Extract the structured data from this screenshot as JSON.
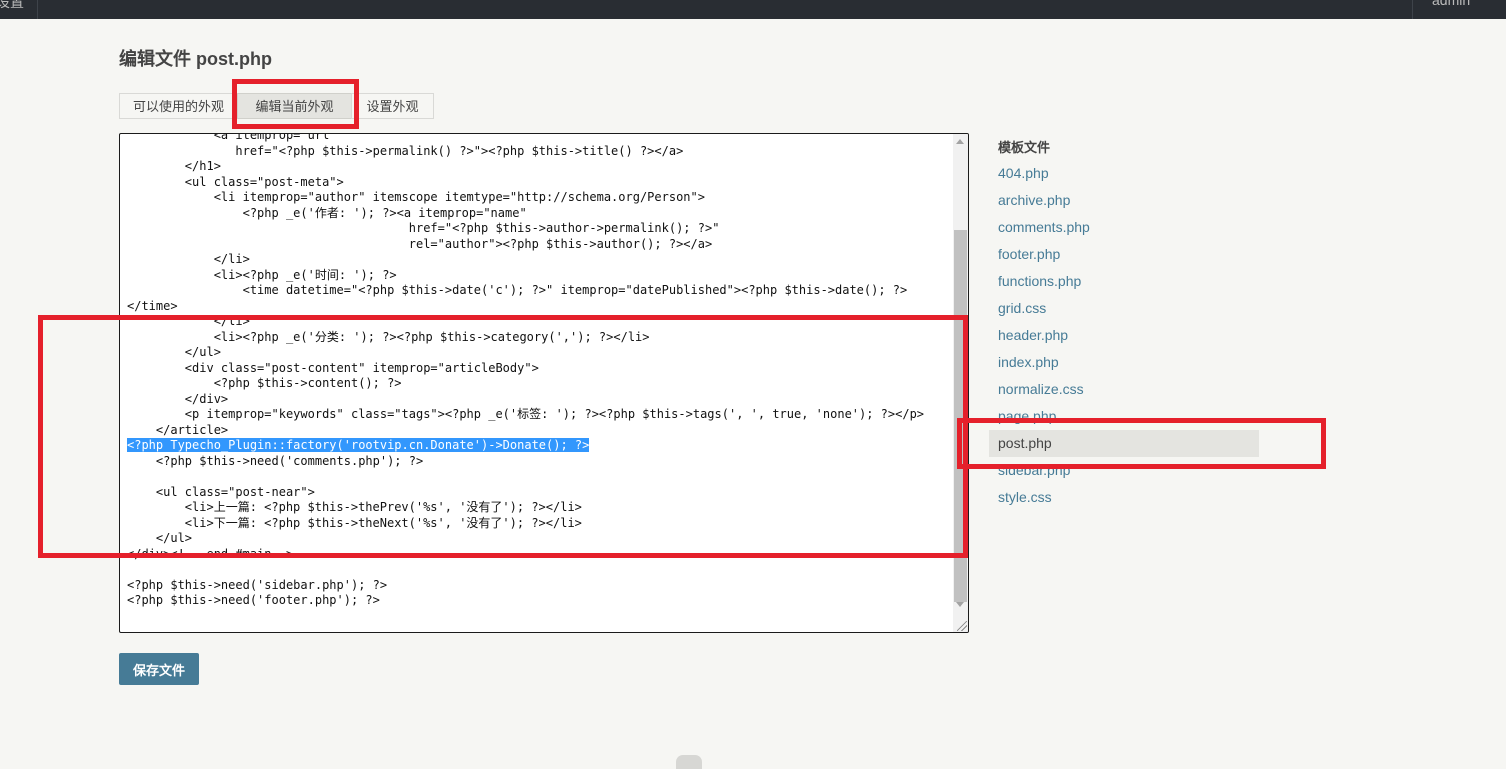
{
  "topbar": {
    "left_text": "设置",
    "user": "admin"
  },
  "page_title": "编辑文件 post.php",
  "tabs": [
    {
      "label": "可以使用的外观",
      "active": false
    },
    {
      "label": "编辑当前外观",
      "active": true
    },
    {
      "label": "设置外观",
      "active": false
    }
  ],
  "code_lines": [
    "            <a itemprop=\"url\"",
    "               href=\"<?php $this->permalink() ?>\"><?php $this->title() ?></a>",
    "        </h1>",
    "        <ul class=\"post-meta\">",
    "            <li itemprop=\"author\" itemscope itemtype=\"http://schema.org/Person\">",
    "                <?php _e('作者: '); ?><a itemprop=\"name\"",
    "                                       href=\"<?php $this->author->permalink(); ?>\"",
    "                                       rel=\"author\"><?php $this->author(); ?></a>",
    "            </li>",
    "            <li><?php _e('时间: '); ?>",
    "                <time datetime=\"<?php $this->date('c'); ?>\" itemprop=\"datePublished\"><?php $this->date(); ?>",
    "</time>",
    "            </li>",
    "            <li><?php _e('分类: '); ?><?php $this->category(','); ?></li>",
    "        </ul>",
    "        <div class=\"post-content\" itemprop=\"articleBody\">",
    "            <?php $this->content(); ?>",
    "        </div>",
    "        <p itemprop=\"keywords\" class=\"tags\"><?php _e('标签: '); ?><?php $this->tags(', ', true, 'none'); ?></p>",
    "    </article>",
    "<?php Typecho_Plugin::factory('rootvip.cn.Donate')->Donate(); ?>",
    "    <?php $this->need('comments.php'); ?>",
    "",
    "    <ul class=\"post-near\">",
    "        <li>上一篇: <?php $this->thePrev('%s', '没有了'); ?></li>",
    "        <li>下一篇: <?php $this->theNext('%s', '没有了'); ?></li>",
    "    </ul>",
    "</div><!-- end #main-->",
    "",
    "<?php $this->need('sidebar.php'); ?>",
    "<?php $this->need('footer.php'); ?>"
  ],
  "highlighted_line_index": 20,
  "save_button": "保存文件",
  "sidebar": {
    "title": "模板文件",
    "files": [
      "404.php",
      "archive.php",
      "comments.php",
      "footer.php",
      "functions.php",
      "grid.css",
      "header.php",
      "index.php",
      "normalize.css",
      "page.php",
      "post.php",
      "sidebar.php",
      "style.css"
    ],
    "current": "post.php"
  },
  "colors": {
    "accent": "#467b96",
    "annotation": "#e5202b",
    "selection": "#3297fd"
  }
}
